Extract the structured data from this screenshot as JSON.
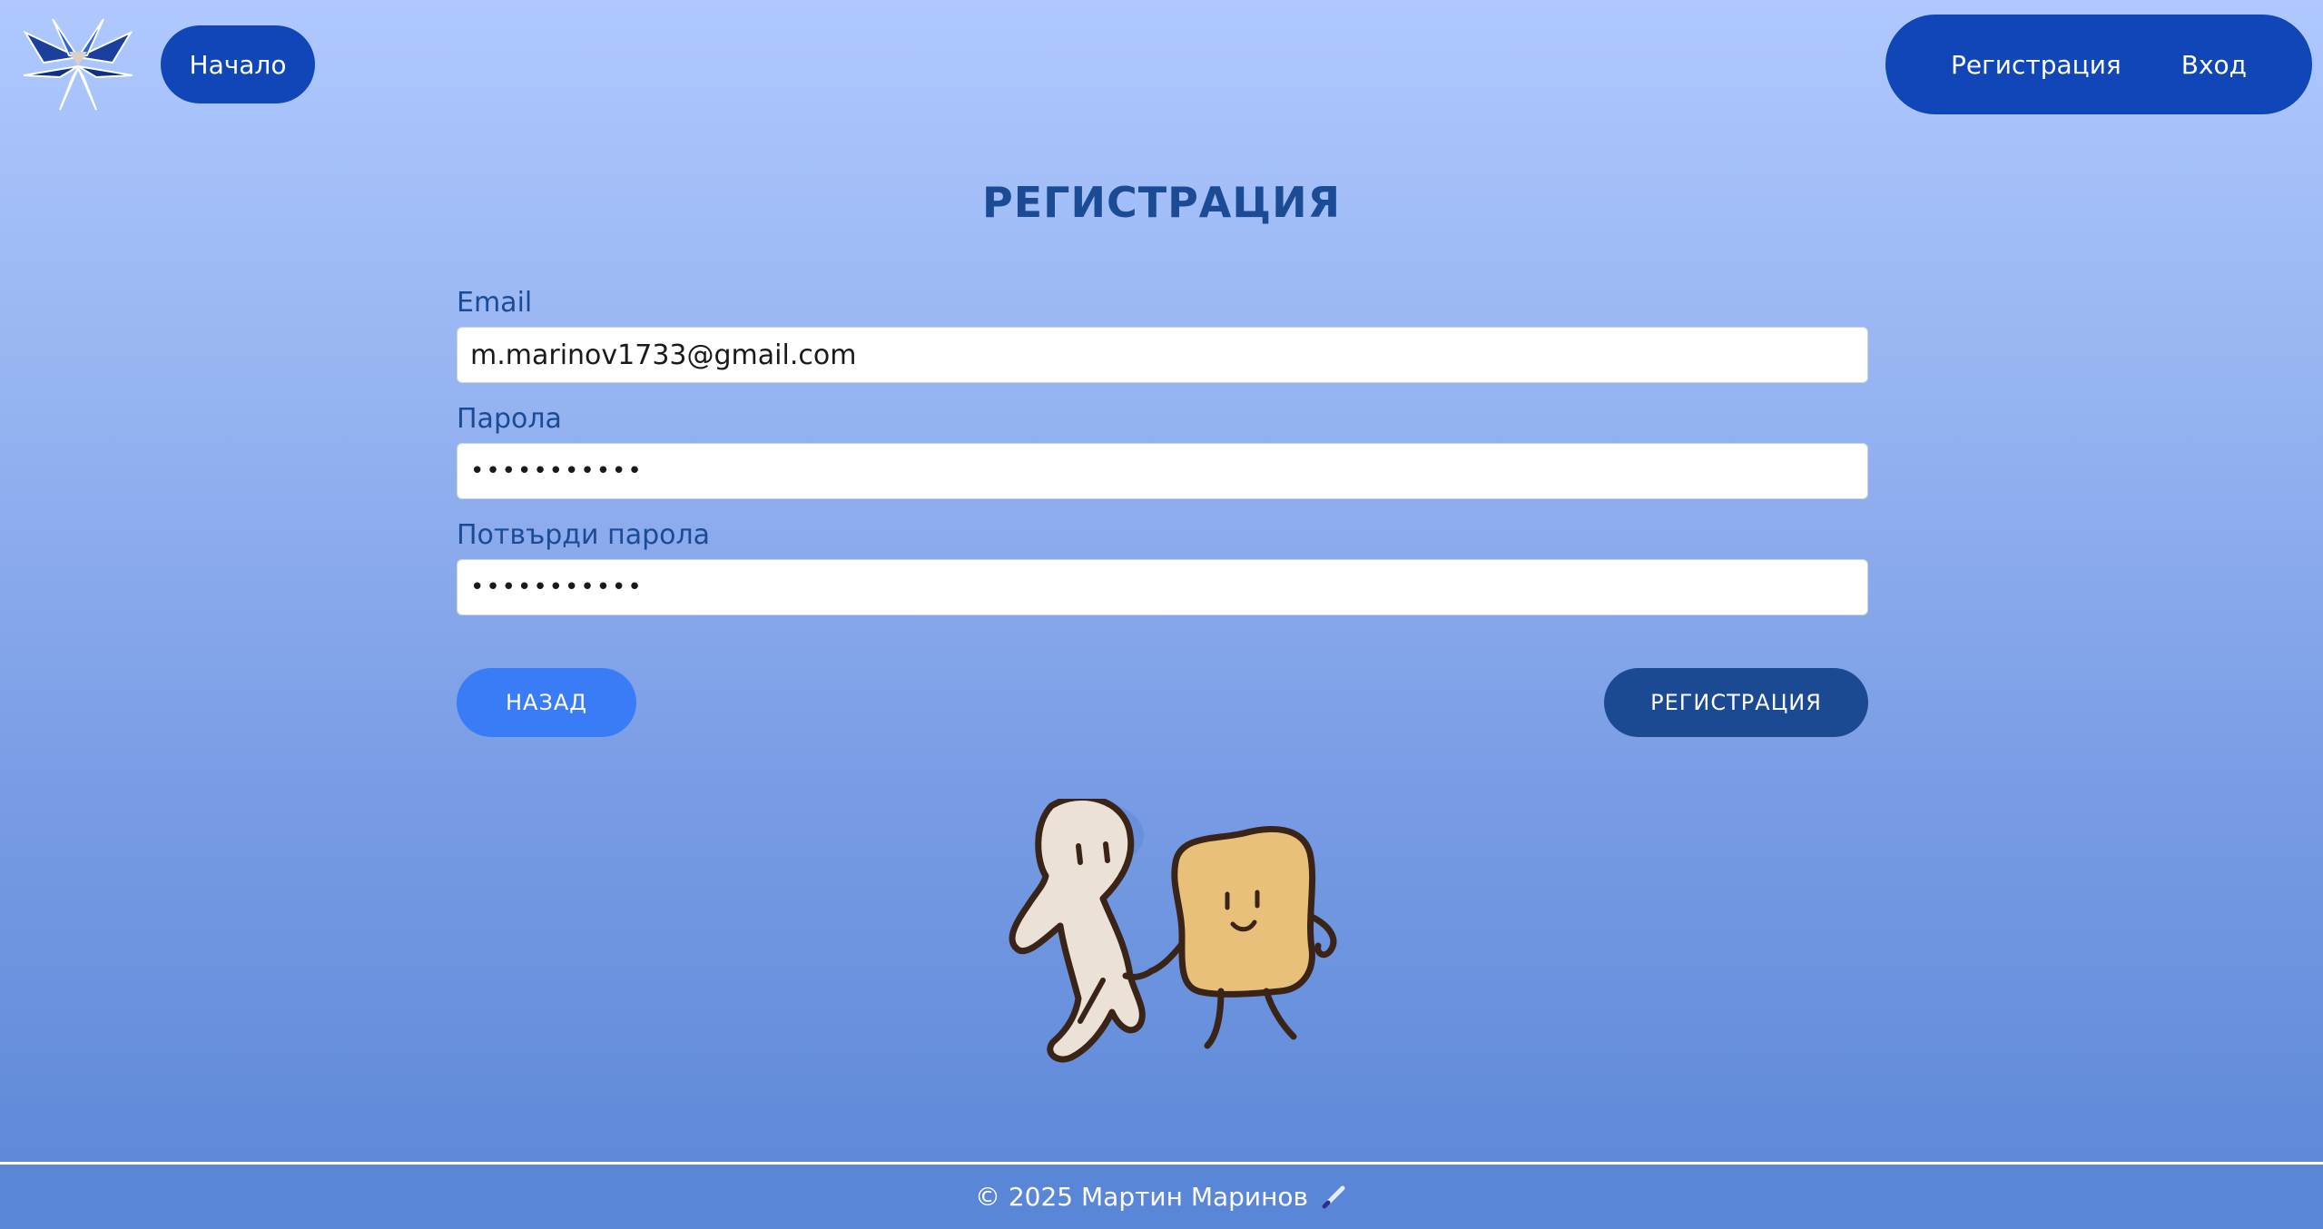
{
  "header": {
    "home_label": "Начало",
    "nav": [
      {
        "label": "Регистрация"
      },
      {
        "label": "Вход"
      }
    ]
  },
  "page": {
    "title": "РЕГИСТРАЦИЯ"
  },
  "form": {
    "email": {
      "label": "Email",
      "value": "m.marinov1733@gmail.com"
    },
    "password": {
      "label": "Парола",
      "value": "•••••••••••"
    },
    "confirm": {
      "label": "Потвърди парола",
      "value": "•••••••••••"
    },
    "back_label": "НАЗАД",
    "submit_label": "РЕГИСТРАЦИЯ"
  },
  "footer": {
    "text": "© 2025 Мартин Маринов"
  },
  "colors": {
    "primary": "#1046b8",
    "accent": "#3a7cf6",
    "title": "#1b4b95"
  },
  "icons": {
    "logo": "star-logo-icon",
    "footer": "pen-icon",
    "illustration": "walking-characters-illustration"
  }
}
